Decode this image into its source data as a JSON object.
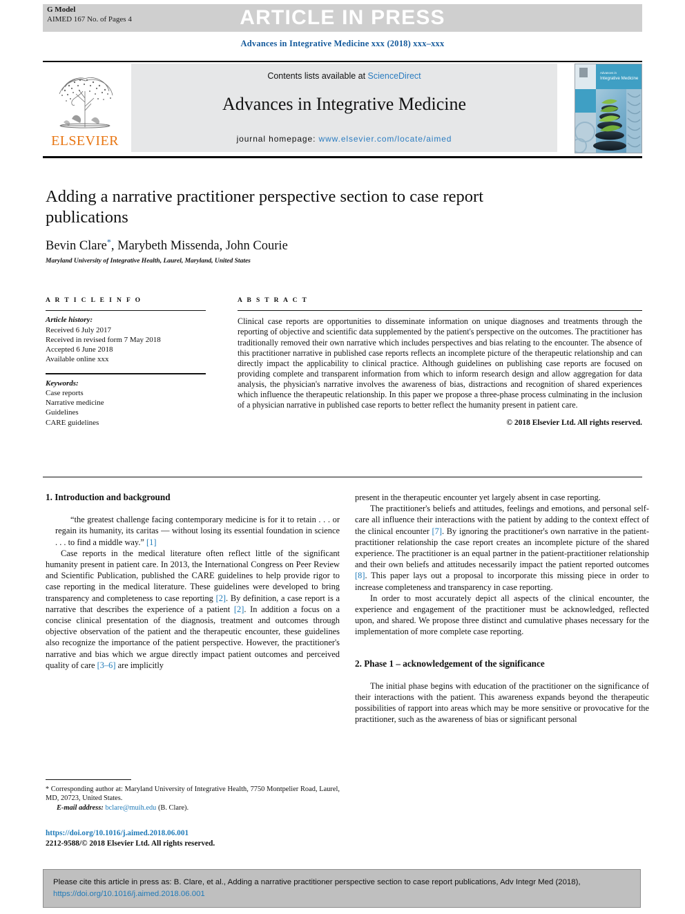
{
  "banner": {
    "article_in_press": "ARTICLE IN PRESS",
    "g_model": "G Model",
    "model_id": "AIMED 167 No. of Pages 4"
  },
  "journal_running_head": "Advances in Integrative Medicine xxx (2018) xxx–xxx",
  "masthead": {
    "contents_prefix": "Contents lists available at ",
    "sciencedirect": "ScienceDirect",
    "journal_title": "Advances in Integrative Medicine",
    "homepage_label": "journal homepage: ",
    "homepage_url": "www.elsevier.com/locate/aimed",
    "publisher": "ELSEVIER",
    "cover_caption": "Advances in Integrative Medicine",
    "tree_icon": "elsevier-tree-icon"
  },
  "article": {
    "title": "Adding a narrative practitioner perspective section to case report publications",
    "authors": "Bevin Clare, Marybeth Missenda, John Courie",
    "corresponding_marker": "*",
    "affiliation": "Maryland University of Integrative Health, Laurel, Maryland, United States"
  },
  "article_info": {
    "heading": "A R T I C L E  I N F O",
    "history_label": "Article history:",
    "history": [
      "Received 6 July 2017",
      "Received in revised form 7 May 2018",
      "Accepted 6 June 2018",
      "Available online xxx"
    ],
    "keywords_label": "Keywords:",
    "keywords": [
      "Case reports",
      "Narrative medicine",
      "Guidelines",
      "CARE guidelines"
    ]
  },
  "abstract": {
    "heading": "A B S T R A C T",
    "text": "Clinical case reports are opportunities to disseminate information on unique diagnoses and treatments through the reporting of objective and scientific data supplemented by the patient's perspective on the outcomes. The practitioner has traditionally removed their own narrative which includes perspectives and bias relating to the encounter. The absence of this practitioner narrative in published case reports reflects an incomplete picture of the therapeutic relationship and can directly impact the applicability to clinical practice. Although guidelines on publishing case reports are focused on providing complete and transparent information from which to inform research design and allow aggregation for data analysis, the physician's narrative involves the awareness of bias, distractions and recognition of shared experiences which influence the therapeutic relationship. In this paper we propose a three-phase process culminating in the inclusion of a physician narrative in published case reports to better reflect the humanity present in patient care.",
    "copyright": "© 2018 Elsevier Ltd. All rights reserved."
  },
  "body": {
    "left": {
      "section_heading": "1. Introduction and background",
      "quote_text": "“the greatest challenge facing contemporary medicine is for it to retain . . . or regain its humanity, its caritas — without losing its essential foundation in science . . . to find a middle way.” ",
      "quote_ref": "[1]",
      "para1_a": "Case reports in the medical literature often reflect little of the significant humanity present in patient care. In 2013, the International Congress on Peer Review and Scientific Publication, published the CARE guidelines to help provide rigor to case reporting in the medical literature. These guidelines were developed to bring transparency and completeness to case reporting ",
      "para1_ref1": "[2]",
      "para1_b": ". By definition, a case report is a narrative that describes the experience of a patient ",
      "para1_ref2": "[2]",
      "para1_c": ". In addition a focus on a concise clinical presentation of the diagnosis, treatment and outcomes through objective observation of the patient and the therapeutic encounter, these guidelines also recognize the importance of the patient perspective. However, the practitioner's narrative and bias which we argue directly impact patient outcomes and perceived quality of care ",
      "para1_ref3": "[3–6]",
      "para1_d": " are implicitly"
    },
    "right": {
      "para_cont": "present in the therapeutic encounter yet largely absent in case reporting.",
      "para2_a": "The practitioner's beliefs and attitudes, feelings and emotions, and personal self-care all influence their interactions with the patient by adding to the context effect of the clinical encounter ",
      "para2_ref1": "[7]",
      "para2_b": ". By ignoring the practitioner's own narrative in the patient-practitioner relationship the case report creates an incomplete picture of the shared experience. The practitioner is an equal partner in the patient-practitioner relationship and their own beliefs and attitudes necessarily impact the patient reported outcomes ",
      "para2_ref2": "[8]",
      "para2_c": ". This paper lays out a proposal to incorporate this missing piece in order to increase completeness and transparency in case reporting.",
      "para3": "In order to most accurately depict all aspects of the clinical encounter, the experience and engagement of the practitioner must be acknowledged, reflected upon, and shared. We propose three distinct and cumulative phases necessary for the implementation of more complete case reporting.",
      "section_heading": "2. Phase 1 – acknowledgement of the significance",
      "para4": "The initial phase begins with education of the practitioner on the significance of their interactions with the patient. This awareness expands beyond the therapeutic possibilities of rapport into areas which may be more sensitive or provocative for the practitioner, such as the awareness of bias or significant personal"
    }
  },
  "footnote": {
    "star": "*",
    "corresponding": " Corresponding author at: Maryland University of Integrative Health, 7750 Montpelier Road, Laurel, MD, 20723, United States.",
    "email_label": "E-mail address:",
    "email": "bclare@muih.edu",
    "email_owner": " (B. Clare).",
    "doi_url": "https://doi.org/10.1016/j.aimed.2018.06.001",
    "issn_line": "2212-9588/© 2018 Elsevier Ltd. All rights reserved."
  },
  "cite_box": {
    "text": "Please cite this article in press as: B. Clare, et al., Adding a narrative practitioner perspective section to case report publications, Adv Integr Med (2018), ",
    "doi": "https://doi.org/10.1016/j.aimed.2018.06.001"
  },
  "colors": {
    "link_blue": "#2b7cc0",
    "ref_blue": "#1f7ab8",
    "header_blue": "#13599b",
    "elsevier_orange": "#e87613",
    "banner_gray": "#cfcfcf",
    "masthead_gray": "#e6e7e8",
    "cite_gray": "#bfbfbf"
  }
}
